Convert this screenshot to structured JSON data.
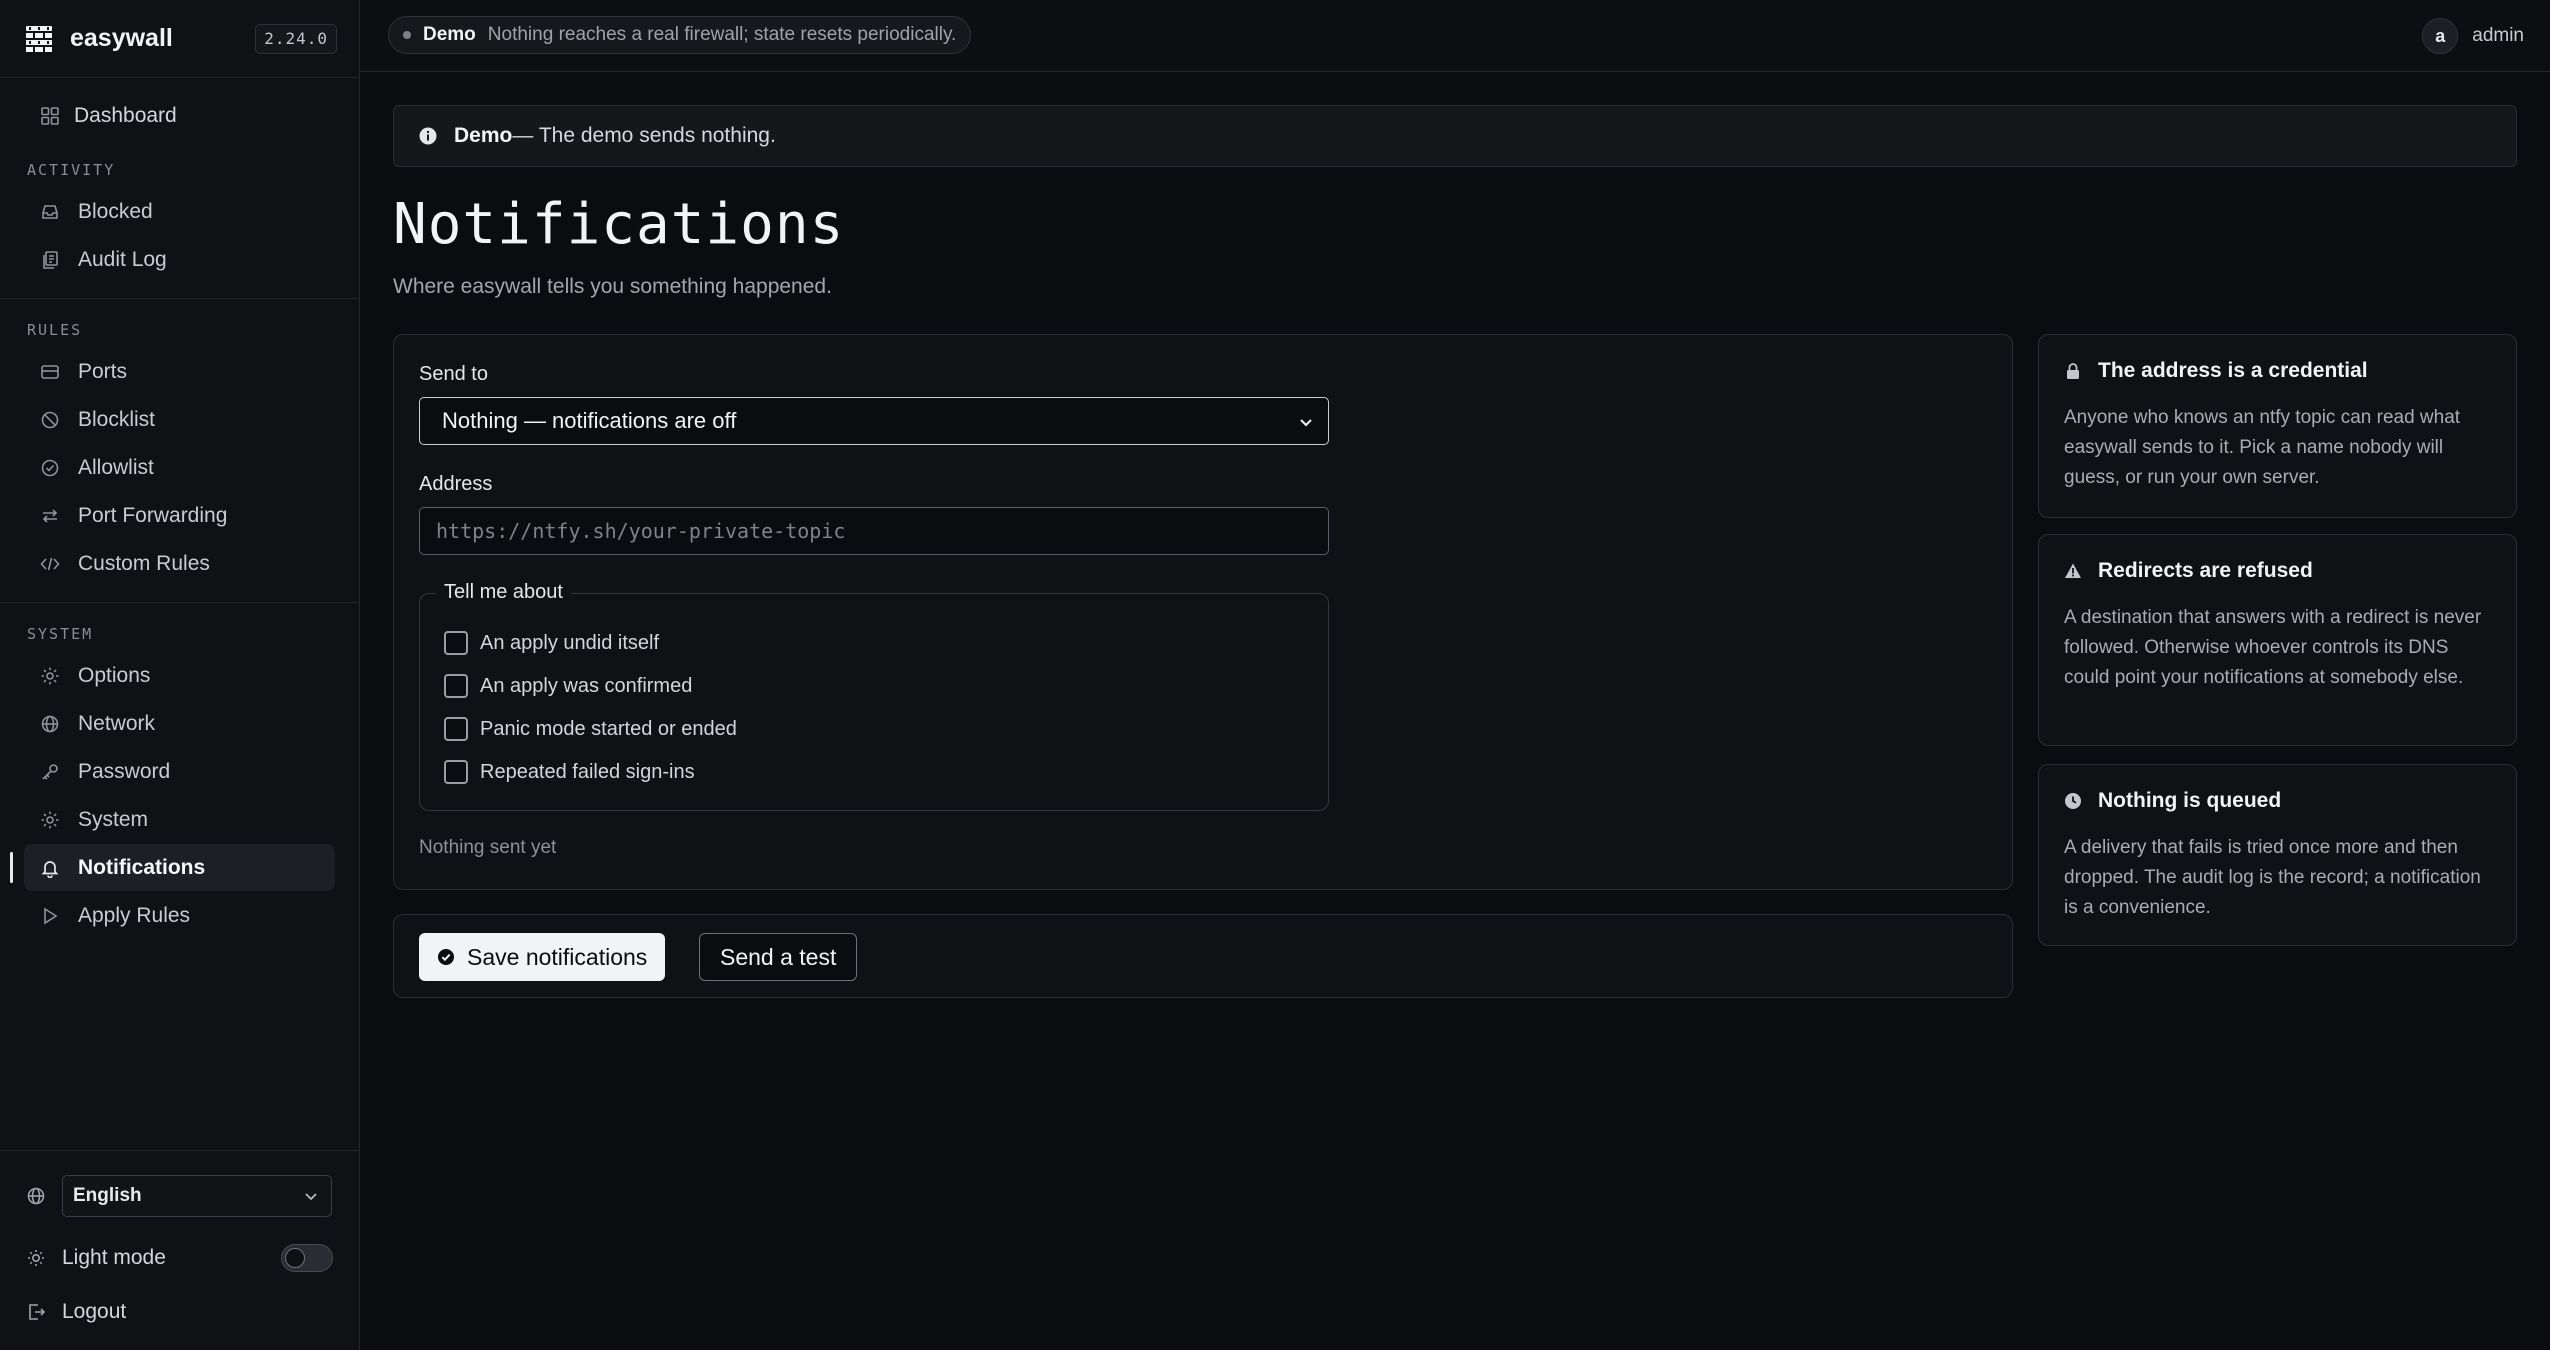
{
  "app": {
    "name": "easywall",
    "version": "2.24.0"
  },
  "topbar": {
    "demo_label": "Demo",
    "demo_text": "Nothing reaches a real firewall; state resets periodically.",
    "user_initial": "a",
    "user_name": "admin"
  },
  "sidebar": {
    "dashboard": "Dashboard",
    "sections": [
      {
        "label": "ACTIVITY",
        "items": [
          "Blocked",
          "Audit Log"
        ]
      },
      {
        "label": "RULES",
        "items": [
          "Ports",
          "Blocklist",
          "Allowlist",
          "Port Forwarding",
          "Custom Rules"
        ]
      },
      {
        "label": "SYSTEM",
        "items": [
          "Options",
          "Network",
          "Password",
          "System",
          "Notifications",
          "Apply Rules"
        ]
      }
    ],
    "active_item": "Notifications",
    "footer": {
      "language": "English",
      "light_mode_label": "Light mode",
      "light_mode_on": false,
      "logout": "Logout"
    }
  },
  "banner": {
    "strong": "Demo",
    "text": " — The demo sends nothing."
  },
  "page": {
    "title": "Notifications",
    "subtitle": "Where easywall tells you something happened."
  },
  "form": {
    "send_to_label": "Send to",
    "send_to_value": "Nothing — notifications are off",
    "address_label": "Address",
    "address_placeholder": "https://ntfy.sh/your-private-topic",
    "address_value": "",
    "tell_me_label": "Tell me about",
    "events": [
      {
        "label": "An apply undid itself",
        "checked": false
      },
      {
        "label": "An apply was confirmed",
        "checked": false
      },
      {
        "label": "Panic mode started or ended",
        "checked": false
      },
      {
        "label": "Repeated failed sign-ins",
        "checked": false
      }
    ],
    "status": "Nothing sent yet"
  },
  "actions": {
    "save": "Save notifications",
    "test": "Send a test"
  },
  "info_cards": [
    {
      "icon": "lock-icon",
      "title": "The address is a credential",
      "body": "Anyone who knows an ntfy topic can read what easywall sends to it. Pick a name nobody will guess, or run your own server."
    },
    {
      "icon": "warning-icon",
      "title": "Redirects are refused",
      "body": "A destination that answers with a redirect is never followed. Otherwise whoever controls its DNS could point your notifications at somebody else."
    },
    {
      "icon": "clock-icon",
      "title": "Nothing is queued",
      "body": "A delivery that fails is tried once more and then dropped. The audit log is the record; a notification is a convenience."
    }
  ]
}
